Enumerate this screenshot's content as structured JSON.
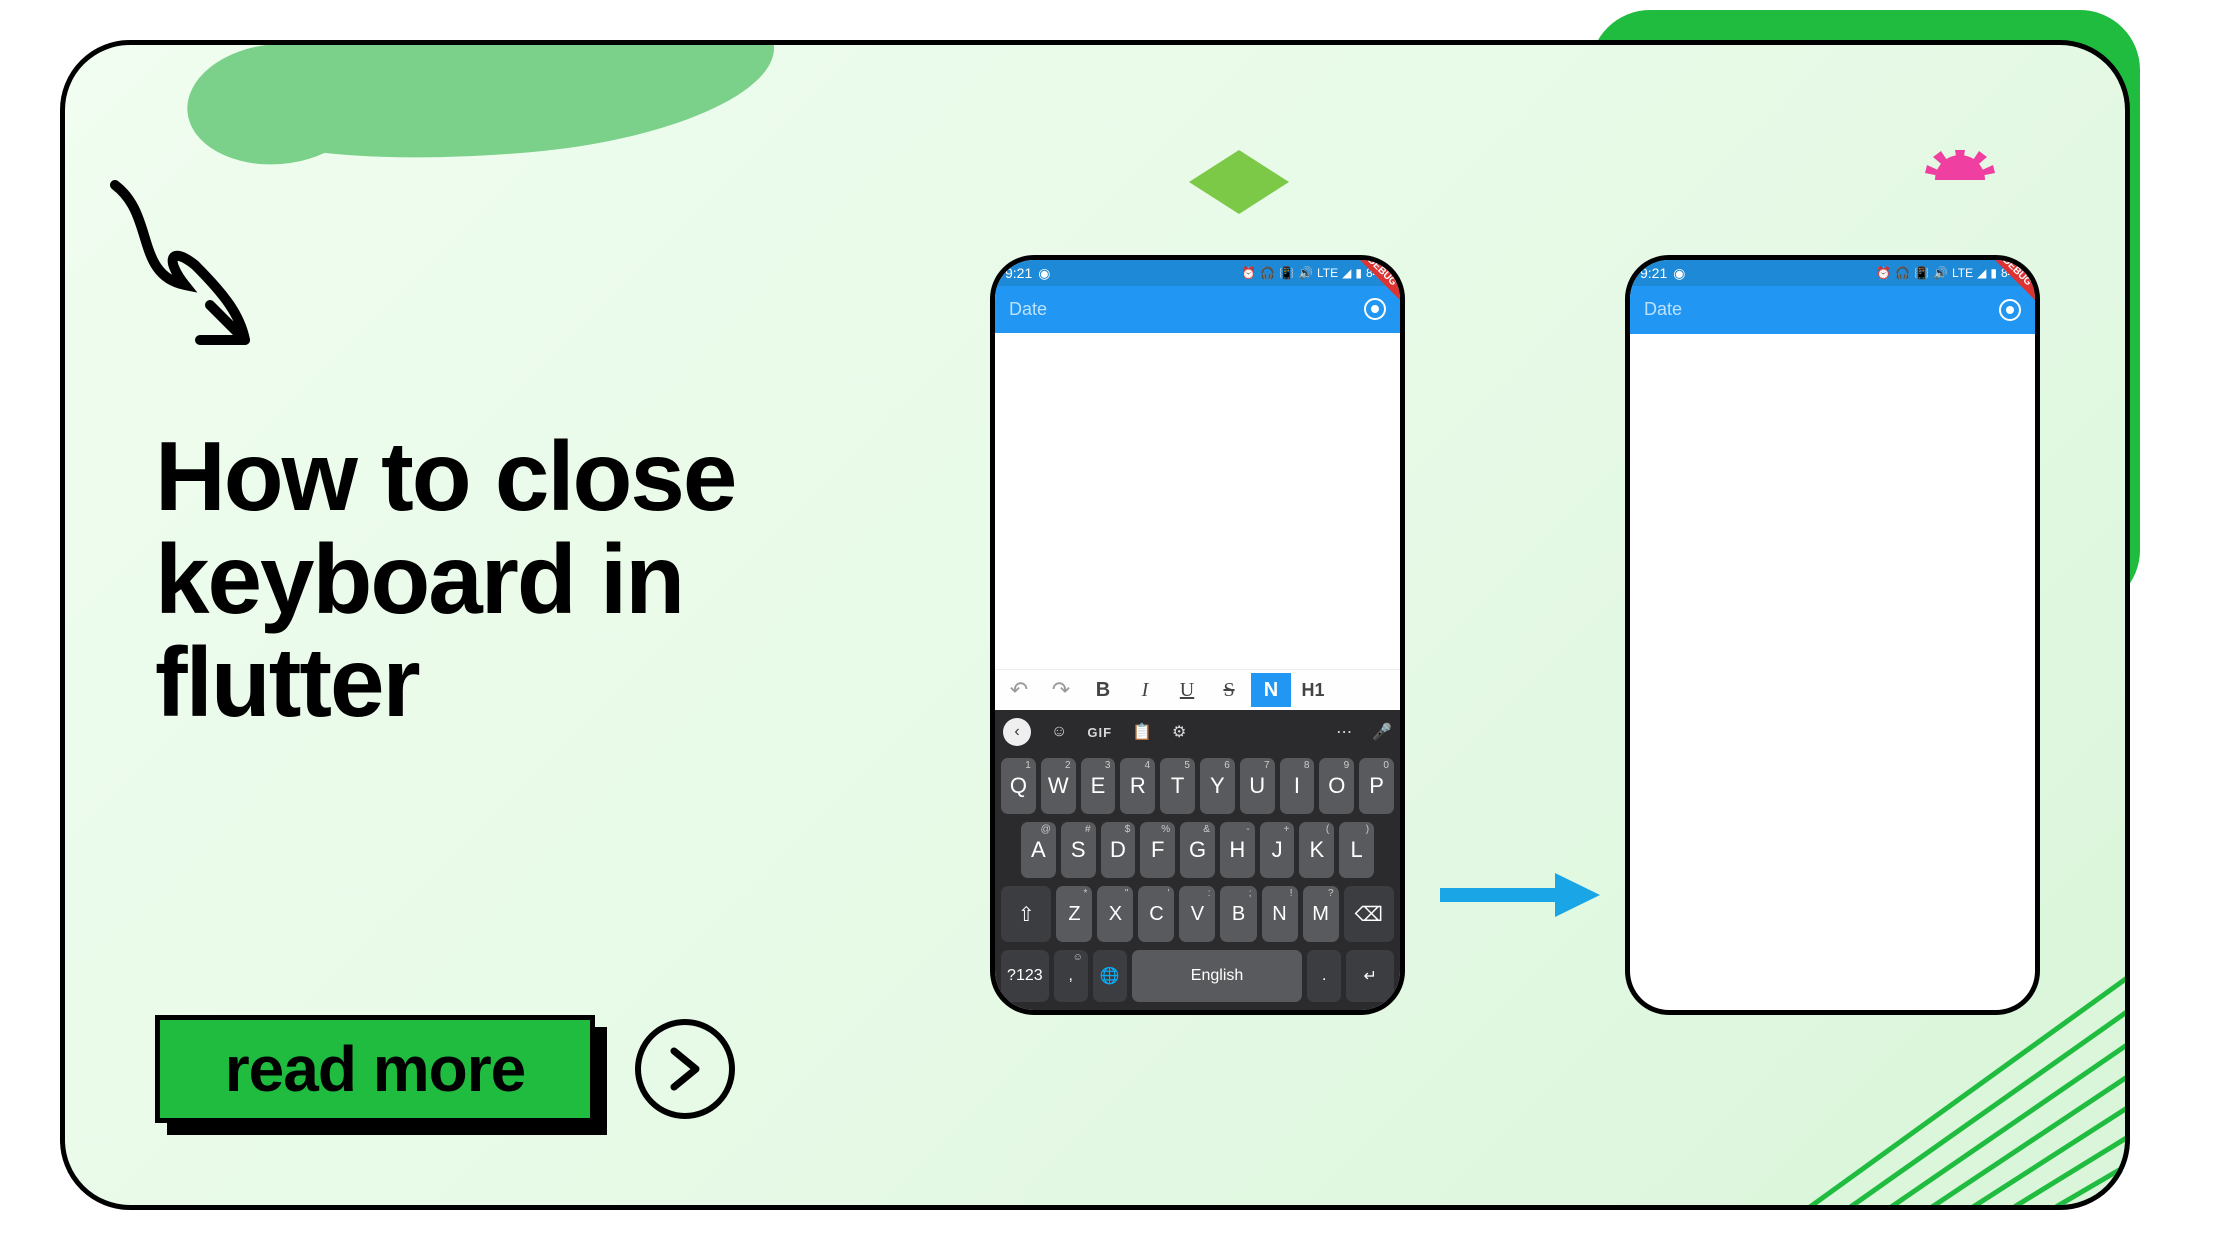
{
  "headline": "How to close keyboard in flutter",
  "cta": {
    "label": "read more"
  },
  "decor": {
    "debug_banner": "DEBUG"
  },
  "phone": {
    "status": {
      "time": "9:21",
      "network": "LTE",
      "battery": "84%"
    },
    "appbar": {
      "title": "Date"
    },
    "format_bar": {
      "undo": "↶",
      "redo": "↷",
      "bold": "B",
      "italic": "I",
      "underline": "U",
      "strike": "S",
      "normal": "N",
      "h1": "H1"
    },
    "keyboard": {
      "suggest": {
        "gif": "GIF"
      },
      "row1": [
        "Q",
        "W",
        "E",
        "R",
        "T",
        "Y",
        "U",
        "I",
        "O",
        "P"
      ],
      "row1_hints": [
        "1",
        "2",
        "3",
        "4",
        "5",
        "6",
        "7",
        "8",
        "9",
        "0"
      ],
      "row2": [
        "A",
        "S",
        "D",
        "F",
        "G",
        "H",
        "J",
        "K",
        "L"
      ],
      "row2_hints": [
        "@",
        "#",
        "$",
        "%",
        "&",
        "-",
        "+",
        "(",
        ")"
      ],
      "row3": [
        "Z",
        "X",
        "C",
        "V",
        "B",
        "N",
        "M"
      ],
      "row3_hints": [
        "*",
        "\"",
        "'",
        ":",
        ";",
        "!",
        "?"
      ],
      "bottom": {
        "sym": "?123",
        "space": "English"
      }
    }
  }
}
